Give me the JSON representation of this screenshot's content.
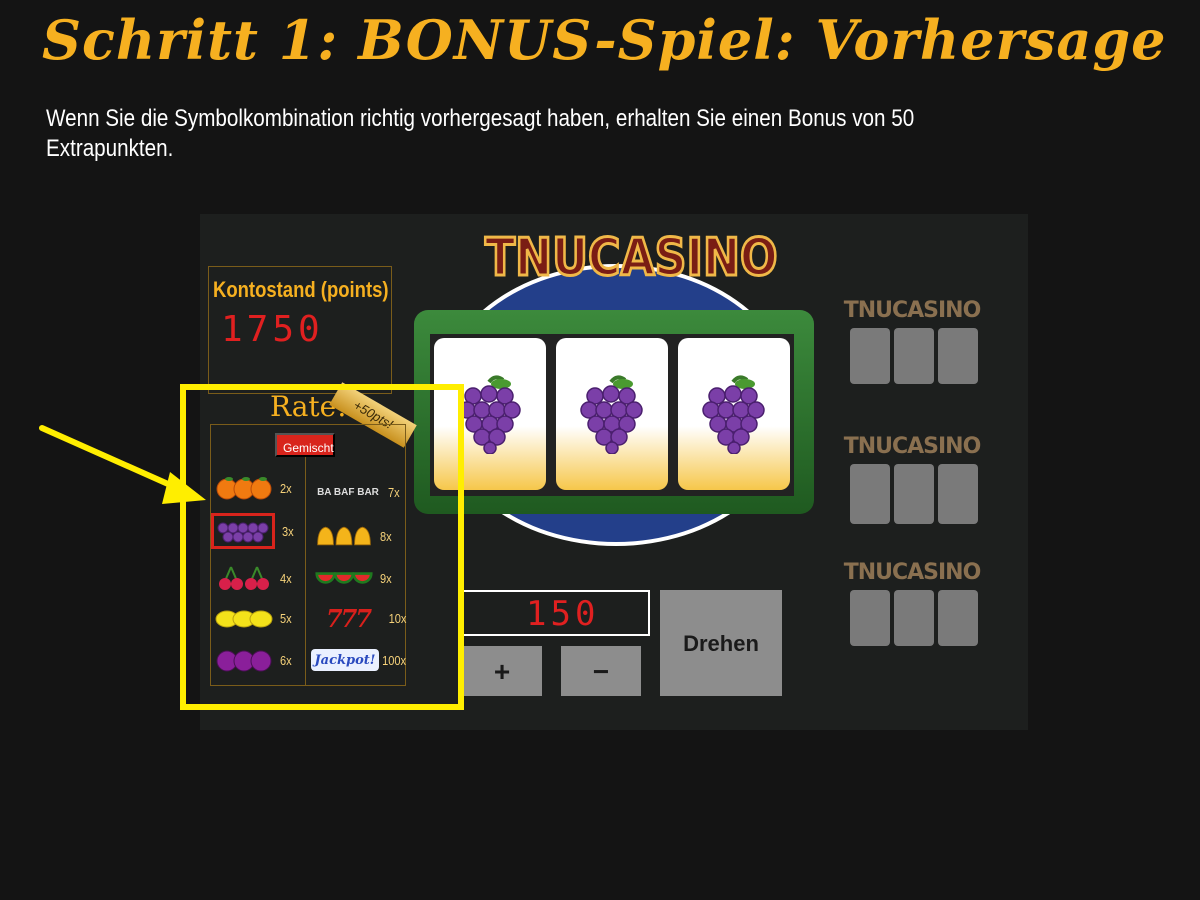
{
  "title": "Schritt 1: BONUS-Spiel: Vorhersage",
  "description": "Wenn Sie die Symbolkombination richtig vorhergesagt haben, erhalten Sie einen Bonus von 50 Extrapunkten.",
  "game": {
    "logo": "TNUCASINO",
    "balance_label": "Kontostand (points)",
    "balance_value": "1750",
    "rate_title": "Rate!",
    "rate_badge": "+50pts!",
    "mixed_button": "Gemischt",
    "payouts": [
      {
        "symbol": "orange",
        "multiplier": "2x"
      },
      {
        "symbol": "grape",
        "multiplier": "3x",
        "selected": true
      },
      {
        "symbol": "cherry",
        "multiplier": "4x"
      },
      {
        "symbol": "lemon",
        "multiplier": "5x"
      },
      {
        "symbol": "plum",
        "multiplier": "6x"
      },
      {
        "symbol": "bar",
        "multiplier": "7x"
      },
      {
        "symbol": "bell",
        "multiplier": "8x"
      },
      {
        "symbol": "watermelon",
        "multiplier": "9x"
      },
      {
        "symbol": "seven",
        "multiplier": "10x"
      },
      {
        "symbol": "jackpot",
        "multiplier": "100x"
      }
    ],
    "bar_text": "BA BAF BAR",
    "seven_text": "777",
    "jackpot_text": "Jackpot!",
    "reels": [
      "grape",
      "grape",
      "grape"
    ],
    "bet_value": "150",
    "plus_label": "+",
    "minus_label": "−",
    "spin_label": "Drehen"
  },
  "colors": {
    "accent": "#f6b020",
    "highlight": "#ffee00",
    "background": "#141414"
  }
}
